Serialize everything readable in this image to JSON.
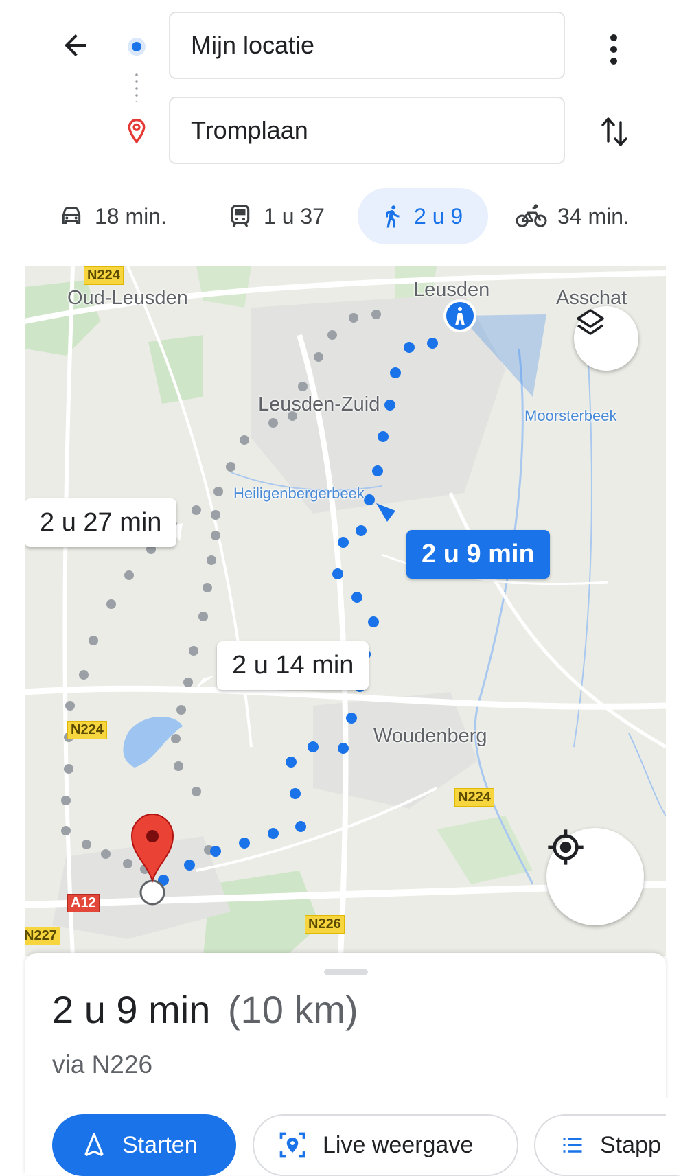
{
  "search": {
    "origin_value": "Mijn locatie",
    "destination_value": "Tromplaan"
  },
  "modes": [
    {
      "icon": "car-icon",
      "label": "18 min."
    },
    {
      "icon": "transit-icon",
      "label": "1 u 37"
    },
    {
      "icon": "walk-icon",
      "label": "2 u 9",
      "selected": true
    },
    {
      "icon": "bike-icon",
      "label": "34 min."
    }
  ],
  "map": {
    "places": {
      "oud_leusden": "Oud-Leusden",
      "leusden": "Leusden",
      "asschat": "Asschat",
      "leusden_zuid": "Leusden-Zuid",
      "moorsterbeek": "Moorsterbeek",
      "heiligenbergerbeek": "Heiligenbergerbeek",
      "woudenberg": "Woudenberg"
    },
    "roads": {
      "n224_a": "N224",
      "n224_b": "N224",
      "a12": "A12",
      "n226": "N226",
      "n227": "N227",
      "top_shield": "N224"
    },
    "route_times": {
      "alt1": "2 u 27 min",
      "alt2": "2 u 14 min",
      "selected": "2 u 9 min"
    }
  },
  "summary": {
    "duration": "2 u 9 min",
    "distance": "(10 km)",
    "via": "via N226"
  },
  "actions": {
    "start": "Starten",
    "live": "Live weergave",
    "steps": "Stapp"
  },
  "colors": {
    "accent": "#1a73e8",
    "pin": "#e53935",
    "alt_route": "#9aa0a6"
  }
}
